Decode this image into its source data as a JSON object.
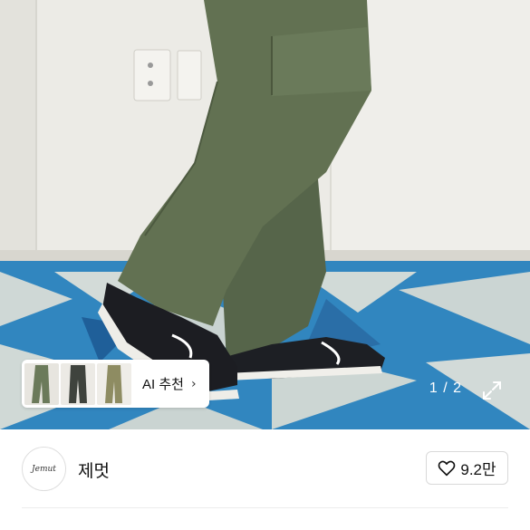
{
  "gallery": {
    "current_page": 1,
    "total_pages": 2,
    "counter_text": "1 / 2"
  },
  "ai_recommend": {
    "label": "AI 추천",
    "chevron": "›",
    "thumbnail_count": 3
  },
  "seller": {
    "avatar_text": "Jemut",
    "name": "제멋"
  },
  "likes": {
    "count_text": "9.2만",
    "icon": "heart-outline-icon"
  },
  "colors": {
    "pants_green": "#5c6b4c",
    "rug_blue": "#2f7fb3",
    "wall": "#ecebe6"
  }
}
